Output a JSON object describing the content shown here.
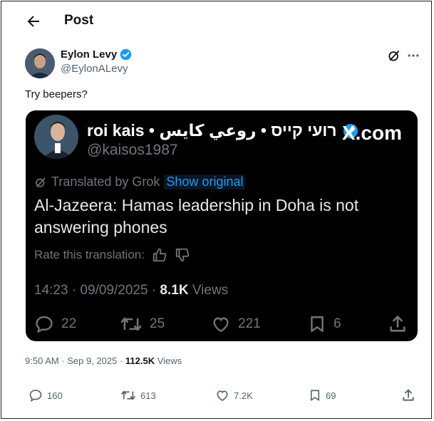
{
  "header": {
    "title": "Post"
  },
  "author": {
    "name": "Eylon Levy",
    "handle": "@EylonALevy"
  },
  "post": {
    "text": "Try beepers?",
    "time": "9:50 AM · Sep 9, 2025 · ",
    "views_count": "112.5K",
    "views_label": " Views"
  },
  "actions": {
    "replies": "160",
    "reposts": "613",
    "likes": "7.2K",
    "bookmarks": "69"
  },
  "embed": {
    "name": "roi kais • רועי קייס • روعي كايس",
    "handle": "@kaisos1987",
    "brand": "X.com",
    "translated_label": "Translated by Grok",
    "show_original": "Show original",
    "text": " Al-Jazeera: Hamas leadership in Doha is not answering phones",
    "rate_label": "Rate this translation:",
    "time": "14:23 · 09/09/2025 · ",
    "views_count": "8.1K",
    "views_label": " Views",
    "replies": "22",
    "reposts": "25",
    "likes": "221",
    "bookmarks": "6"
  },
  "colors": {
    "accent": "#1d9bf0",
    "verified": "#1d9bf0",
    "embed_bg": "#000000",
    "muted": "#536471"
  }
}
